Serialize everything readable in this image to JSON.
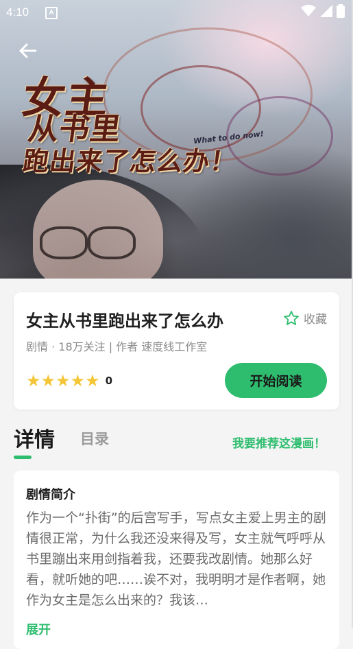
{
  "status_bar": {
    "time": "4:10",
    "notification_icon": "a-icon",
    "wifi_icon": "wifi-icon",
    "signal_icon": "signal-icon",
    "battery_icon": "battery-icon"
  },
  "cover": {
    "art_title_line1": "女主",
    "art_title_line2": "从书里",
    "art_title_line3": "跑出来了怎么办！",
    "art_subtitle": "What to do now!"
  },
  "nav": {
    "back_icon": "arrow-left-icon"
  },
  "book": {
    "title": "女主从书里跑出来了怎么办",
    "favorite_label": "收藏",
    "favorite_icon": "star-outline-icon",
    "meta": "剧情 · 18万关注 | 作者 速度线工作室",
    "rating_stars": 5,
    "rating_score": "0",
    "read_button": "开始阅读"
  },
  "tabs": {
    "detail": "详情",
    "catalog": "目录",
    "recommend": "我要推荐这漫画！"
  },
  "synopsis": {
    "heading": "剧情简介",
    "text": "作为一个“扑街”的后宫写手，写点女主爱上男主的剧情很正常，为什么我还没来得及写，女主就气呼呼从书里蹦出来用剑指着我，还要我改剧情。她那么好看，就听她的吧……诶不对，我明明才是作者啊，她作为女主是怎么出来的？我该…",
    "expand": "展开"
  },
  "colors": {
    "accent": "#2ebd6e",
    "star": "#f4c535",
    "background": "#f4f4f4"
  }
}
